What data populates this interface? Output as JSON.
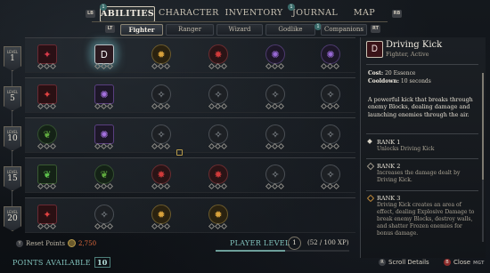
{
  "nav": {
    "lb": "LB",
    "rb": "RB",
    "tabs": [
      {
        "label": "ABILITIES",
        "badge": "1",
        "active": true
      },
      {
        "label": "CHARACTER",
        "badge": "",
        "active": false
      },
      {
        "label": "INVENTORY",
        "badge": "",
        "active": false
      },
      {
        "label": "JOURNAL",
        "badge": "1",
        "active": false
      },
      {
        "label": "MAP",
        "badge": "",
        "active": false
      }
    ],
    "lt": "LT",
    "rt": "RT",
    "subtabs": [
      {
        "label": "Fighter",
        "active": true
      },
      {
        "label": "Ranger",
        "active": false
      },
      {
        "label": "Wizard",
        "active": false
      },
      {
        "label": "Godlike",
        "active": false
      },
      {
        "label": "Companions",
        "badge": "1",
        "active": false
      }
    ]
  },
  "levels": [
    {
      "label": "LEVEL",
      "value": "1"
    },
    {
      "label": "LEVEL",
      "value": "5"
    },
    {
      "label": "LEVEL",
      "value": "10"
    },
    {
      "label": "LEVEL",
      "value": "15"
    },
    {
      "label": "LEVEL",
      "value": "20"
    }
  ],
  "bottom": {
    "reset_btn": "Y",
    "reset_label": "Reset Points",
    "essence": "2,750",
    "points_label": "POINTS AVAILABLE",
    "points_value": "10",
    "player_level_label": "PLAYER LEVEL",
    "player_level_value": "1",
    "xp_text": "(52 / 100 XP)",
    "xp_fraction": 0.52
  },
  "detail": {
    "icon_glyph": "Ꭰ",
    "title": "Driving Kick",
    "subtitle": "Fighter, Active",
    "cost_label": "Cost:",
    "cost_value": "20 Essence",
    "cooldown_label": "Cooldown:",
    "cooldown_value": "10 seconds",
    "description": "A powerful kick that breaks through enemy Blocks, dealing damage and launching enemies through the air.",
    "ranks": [
      {
        "title": "RANK 1",
        "text": "Unlocks Driving Kick",
        "state": "on"
      },
      {
        "title": "RANK 2",
        "text": "Increases the damage dealt by Driving Kick.",
        "state": "off"
      },
      {
        "title": "RANK 3",
        "text": "Driving Kick creates an area of effect, dealing Explosive Damage to break enemy Blocks, destroy walls, and shatter Frozen enemies for bonus damage.",
        "state": "lock"
      }
    ]
  },
  "footer": {
    "scroll_icon": "R",
    "scroll_label": "Scroll Details",
    "close_icon": "B",
    "close_label": "Close",
    "brand": "MGT"
  },
  "icons": {
    "skill_square_red": "✦",
    "skill_selected": "Ꭰ",
    "skill_gold": "✹",
    "skill_red_circle": "✸",
    "skill_purple": "✺",
    "skill_grey": "✧",
    "skill_green": "❦"
  }
}
